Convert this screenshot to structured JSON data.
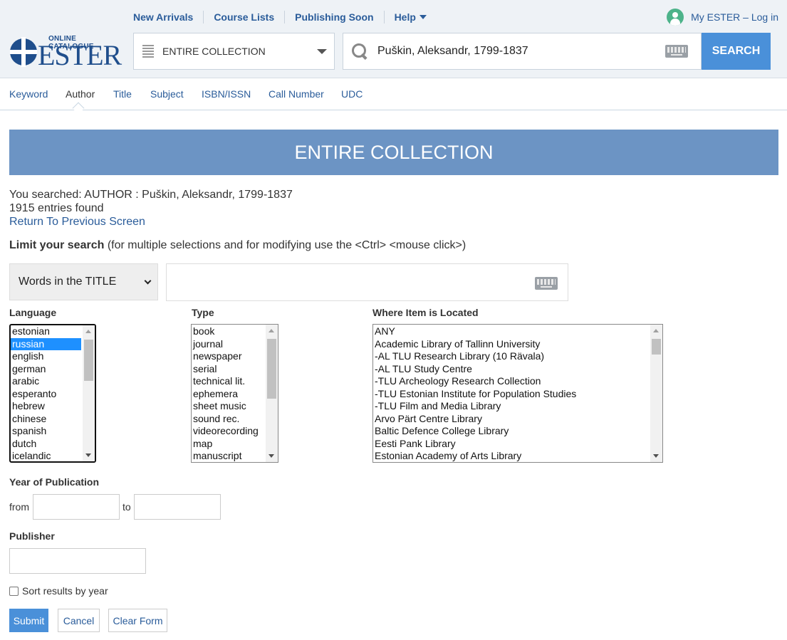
{
  "header": {
    "nav": [
      "New Arrivals",
      "Course Lists",
      "Publishing Soon",
      "Help"
    ],
    "login_label": "My ESTER – Log in",
    "logo_subtitle": "ONLINE CATALOGUE",
    "logo_title": "ESTER",
    "collection_value": "ENTIRE COLLECTION",
    "search_value": "Puškin, Aleksandr, 1799-1837",
    "search_button": "SEARCH",
    "accent_color": "#4a90d9"
  },
  "tabs": [
    {
      "label": "Keyword"
    },
    {
      "label": "Author",
      "active": true
    },
    {
      "label": "Title"
    },
    {
      "label": "Subject"
    },
    {
      "label": "ISBN/ISSN"
    },
    {
      "label": "Call Number"
    },
    {
      "label": "UDC"
    }
  ],
  "banner": {
    "title": "ENTIRE COLLECTION",
    "color": "#6c94c4"
  },
  "results": {
    "searched": "You searched: AUTHOR : Puškin, Aleksandr, 1799-1837",
    "count": "1915 entries found",
    "return_link": "Return To Previous Screen"
  },
  "limit": {
    "heading": "Limit your search",
    "hint": "(for multiple selections and for modifying use the <Ctrl> <mouse click>)",
    "field_select": "Words in the TITLE",
    "words_value": ""
  },
  "language": {
    "label": "Language",
    "options": [
      "estonian",
      "russian",
      "english",
      "german",
      "arabic",
      "esperanto",
      "hebrew",
      "chinese",
      "spanish",
      "dutch",
      "icelandic"
    ],
    "selected": "russian"
  },
  "type": {
    "label": "Type",
    "options": [
      "book",
      "journal",
      "newspaper",
      "serial",
      "technical lit.",
      "ephemera",
      "sheet music",
      "sound rec.",
      "videorecording",
      "map",
      "manuscript"
    ]
  },
  "location": {
    "label": "Where Item is Located",
    "options": [
      "ANY",
      "Academic Library of Tallinn University",
      "-AL TLU Research Library (10 Rävala)",
      "-AL TLU Study Centre",
      "-TLU Archeology Research Collection",
      "-TLU Estonian Institute for Population Studies",
      "-TLU Film and Media Library",
      "Arvo Pärt Centre Library",
      "Baltic Defence College Library",
      "Eesti Pank Library",
      "Estonian Academy of Arts Library"
    ]
  },
  "year": {
    "label": "Year of Publication",
    "from_label": "from",
    "to_label": "to",
    "from_value": "",
    "to_value": ""
  },
  "publisher": {
    "label": "Publisher",
    "value": ""
  },
  "sort": {
    "label": "Sort results by year",
    "checked": false
  },
  "buttons": {
    "submit": "Submit",
    "cancel": "Cancel",
    "clear": "Clear Form"
  }
}
